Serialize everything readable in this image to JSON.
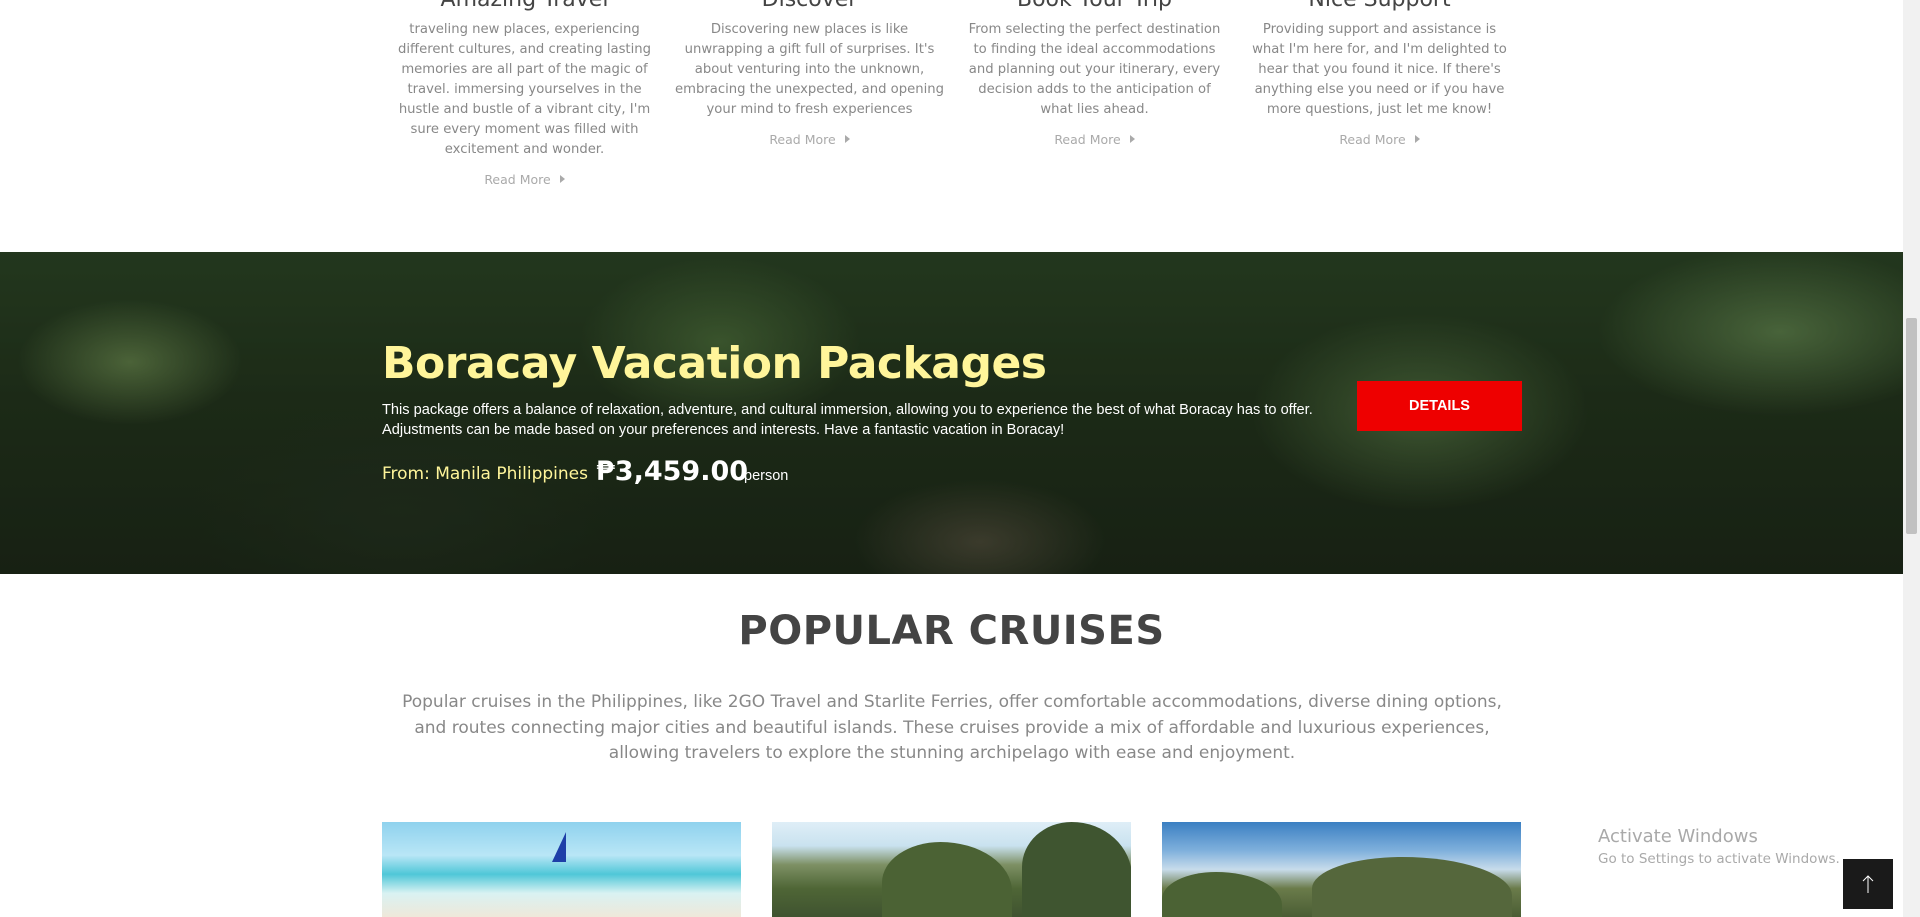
{
  "features": [
    {
      "title": "Amazing Travel",
      "text": "traveling new places, experiencing different cultures, and creating lasting memories are all part of the magic of travel. immersing yourselves in the hustle and bustle of a vibrant city, I'm sure every moment was filled with excitement and wonder.",
      "link": "Read More"
    },
    {
      "title": "Discover",
      "text": "Discovering new places is like unwrapping a gift full of surprises. It's about venturing into the unknown, embracing the unexpected, and opening your mind to fresh experiences",
      "link": "Read More"
    },
    {
      "title": "Book Your Trip",
      "text": "From selecting the perfect destination to finding the ideal accommodations and planning out your itinerary, every decision adds to the anticipation of what lies ahead.",
      "link": "Read More"
    },
    {
      "title": "Nice Support",
      "text": "Providing support and assistance is what I'm here for, and I'm delighted to hear that you found it nice. If there's anything else you need or if you have more questions, just let me know!",
      "link": "Read More"
    }
  ],
  "banner": {
    "title": "Boracay Vacation Packages",
    "description": "This package offers a balance of relaxation, adventure, and cultural immersion, allowing you to experience the best of what Boracay has to offer. Adjustments can be made based on your preferences and interests. Have a fantastic vacation in Boracay!",
    "from": "From: Manila Philippines",
    "price": "₱3,459.00",
    "per": "person",
    "button": "DETAILS",
    "title_color": "#fff59a",
    "button_color": "#ee0000"
  },
  "cruises": {
    "title": "POPULAR CRUISES",
    "description": "Popular cruises in the Philippines, like 2GO Travel and Starlite Ferries, offer comfortable accommodations, diverse dining options, and routes connecting major cities and beautiful islands. These cruises provide a mix of affordable and luxurious experiences, allowing travelers to explore the stunning archipelago with ease and enjoyment."
  },
  "watermark": {
    "line1": "Activate Windows",
    "line2": "Go to Settings to activate Windows."
  },
  "back_to_top": {
    "icon": "arrow-up-icon"
  }
}
